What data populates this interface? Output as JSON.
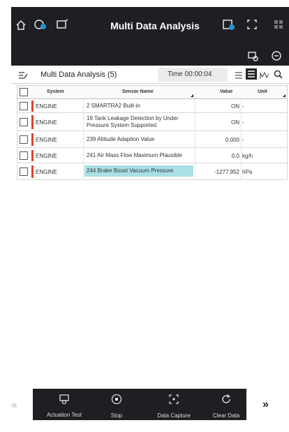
{
  "app": {
    "title": "Multi Data Analysis"
  },
  "toolbar": {
    "list_title": "Multi Data Analysis (5)",
    "time": "Time 00:00:04"
  },
  "table": {
    "headers": {
      "system": "System",
      "sensor": "Sensor Name",
      "value": "Value",
      "unit": "Unit"
    },
    "rows": [
      {
        "system": "ENGINE",
        "sensor": "2 SMARTRA2 Built-in",
        "value": "ON",
        "unit": "-",
        "selected": false
      },
      {
        "system": "ENGINE",
        "sensor": "19 Tank Leakage Detection by Under Pressure System Supported",
        "value": "ON",
        "unit": "-",
        "selected": false
      },
      {
        "system": "ENGINE",
        "sensor": "239 Altitude Adaption Value",
        "value": "0.000",
        "unit": "-",
        "selected": false
      },
      {
        "system": "ENGINE",
        "sensor": "241 Air Mass Flow Maximum Plausible",
        "value": "0.0",
        "unit": "kg/h",
        "selected": false
      },
      {
        "system": "ENGINE",
        "sensor": "244 Brake Boost Vacuum Pressure",
        "value": "-1277.952",
        "unit": "hPa",
        "selected": true
      }
    ]
  },
  "bottom": {
    "actuation": "Actuation Test",
    "stop": "Stop",
    "capture": "Data Capture",
    "clear": "Clear Data",
    "prev": "«",
    "next": "»"
  },
  "colors": {
    "bar": "#1d1f23",
    "engine_marker": "#d9442d",
    "selected_row": "#a9e0e6"
  },
  "icons": [
    "home-icon",
    "vehicle-icon",
    "scan-icon",
    "record-icon",
    "fullscreen-icon",
    "grid-icon",
    "car-settings-icon",
    "wrench-icon",
    "edit-list-icon",
    "list-view-icon",
    "text-view-icon",
    "graph-view-icon",
    "search-icon",
    "sort-icon"
  ]
}
